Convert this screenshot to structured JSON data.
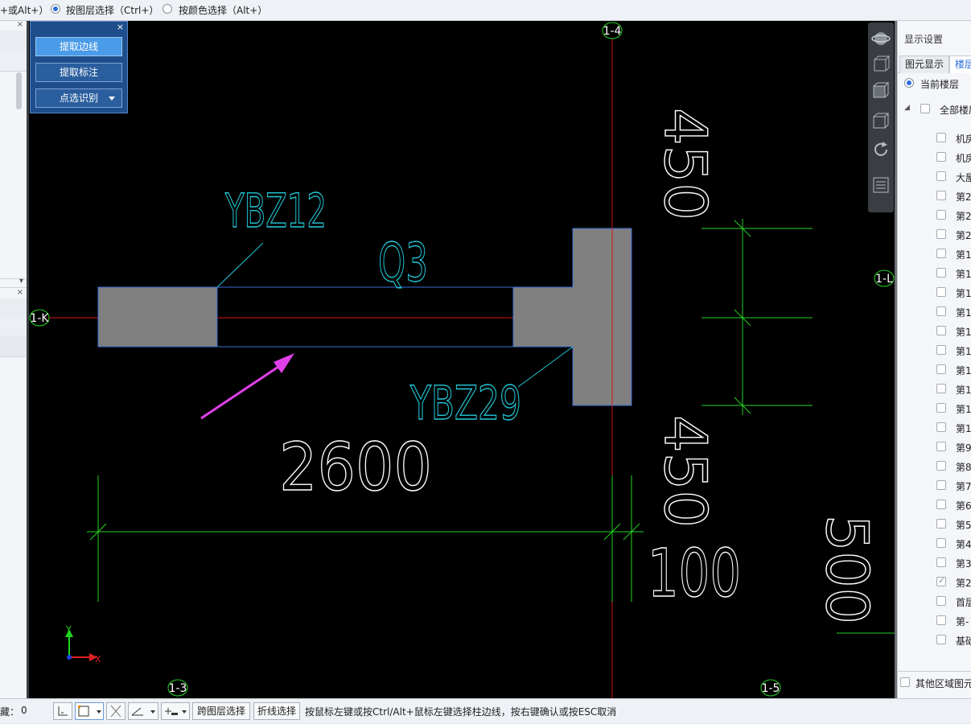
{
  "topbar": {
    "partial_text": "+或Alt+）",
    "radio_layer_label": "按图层选择（Ctrl+）",
    "radio_layer_selected": true,
    "radio_color_label": "按颜色选择（Alt+）",
    "radio_color_selected": false
  },
  "float_panel": {
    "close": "×",
    "btn_extract_edges": "提取边线",
    "btn_extract_labels": "提取标注",
    "btn_point_identify": "点选识别"
  },
  "cad": {
    "axes": [
      "1-4",
      "1-K",
      "1-L",
      "1-3",
      "1-5"
    ],
    "labels": {
      "ybz12": "YBZ12",
      "q3": "Q3",
      "ybz29": "YBZ29",
      "dim_2600": "2600",
      "dim_450_top": "450",
      "dim_450_bottom": "450",
      "dim_100": "100",
      "dim_500": "500"
    },
    "ucs": {
      "x": "X",
      "y": "Y"
    },
    "colors": {
      "axis": "#d01818",
      "dim": "#22d422",
      "text_white": "#ffffff",
      "text_cyan": "#22c8d8",
      "fill": "#808080",
      "outline": "#3c6ed8",
      "arrow": "#e040e8"
    }
  },
  "right_panel": {
    "title": "显示设置",
    "tab_element": "图元显示",
    "tab_floor": "楼层",
    "radio_current_floor": "当前楼层",
    "all_floors": "全部楼层",
    "floors": [
      {
        "label": "机房",
        "checked": false
      },
      {
        "label": "机房",
        "checked": false
      },
      {
        "label": "大屋",
        "checked": false
      },
      {
        "label": "第2",
        "checked": false
      },
      {
        "label": "第2",
        "checked": false
      },
      {
        "label": "第2",
        "checked": false
      },
      {
        "label": "第1",
        "checked": false
      },
      {
        "label": "第1",
        "checked": false
      },
      {
        "label": "第1",
        "checked": false
      },
      {
        "label": "第1",
        "checked": false
      },
      {
        "label": "第1",
        "checked": false
      },
      {
        "label": "第1",
        "checked": false
      },
      {
        "label": "第1",
        "checked": false
      },
      {
        "label": "第1",
        "checked": false
      },
      {
        "label": "第1",
        "checked": false
      },
      {
        "label": "第1",
        "checked": false
      },
      {
        "label": "第9",
        "checked": false
      },
      {
        "label": "第8",
        "checked": false
      },
      {
        "label": "第7",
        "checked": false
      },
      {
        "label": "第6",
        "checked": false
      },
      {
        "label": "第5",
        "checked": false
      },
      {
        "label": "第4",
        "checked": false
      },
      {
        "label": "第3",
        "checked": false
      },
      {
        "label": "第2",
        "checked": true
      },
      {
        "label": "首层",
        "checked": false
      },
      {
        "label": "第-",
        "checked": false
      },
      {
        "label": "基础",
        "checked": false
      }
    ],
    "other_region": "其他区域图元"
  },
  "statusbar": {
    "hidden_label": "藏：",
    "hidden_count": "0",
    "btn_cross_layer": "跨图层选择",
    "btn_polyline": "折线选择",
    "hint": "按鼠标左键或按Ctrl/Alt+鼠标左键选择柱边线，按右键确认或按ESC取消"
  }
}
